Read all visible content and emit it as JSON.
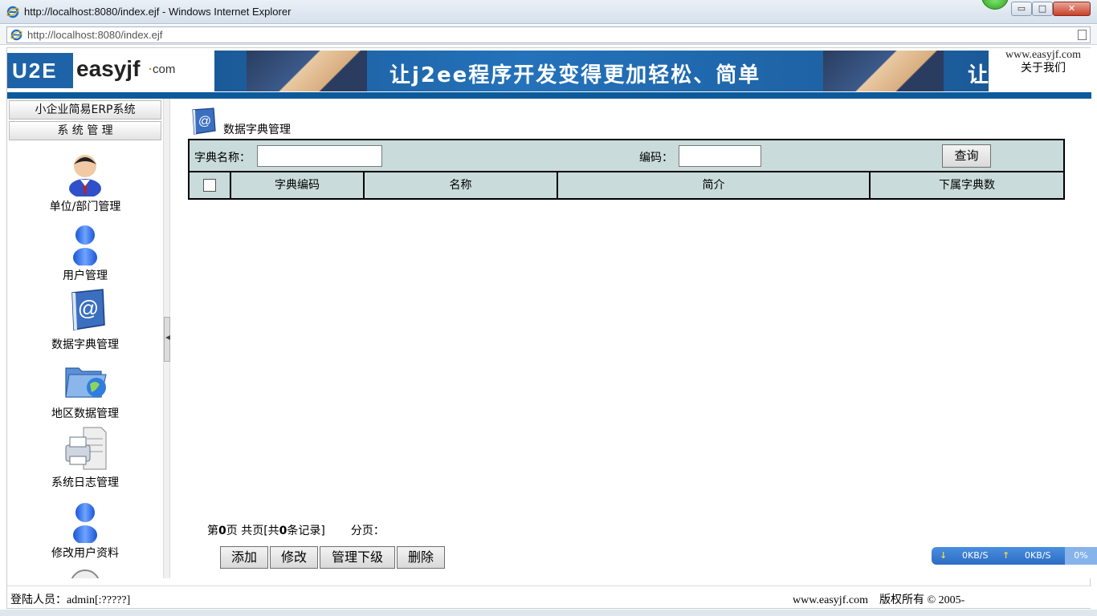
{
  "browser": {
    "window_title": "http://localhost:8080/index.ejf - Windows Internet Explorer",
    "url": "http://localhost:8080/index.ejf",
    "min_glyph": "▭",
    "max_glyph": "□",
    "close_glyph": "✕"
  },
  "header": {
    "logo_mark": "U2E",
    "logo_brand": "easyjf",
    "logo_dot": "·",
    "logo_suffix": "com",
    "banner_slogan": "让j2ee程序开发变得更加轻松、简单",
    "banner_slogan_cut": "让",
    "site": "www.easyjf.com",
    "about": "关于我们"
  },
  "sidebar": {
    "tabs": [
      "小企业简易ERP系统",
      "系 统 管 理"
    ],
    "items": [
      {
        "label": "单位/部门管理",
        "icon": "manager-person-icon"
      },
      {
        "label": "用户管理",
        "icon": "user-person-icon"
      },
      {
        "label": "数据字典管理",
        "icon": "address-book-icon"
      },
      {
        "label": "地区数据管理",
        "icon": "folder-globe-icon"
      },
      {
        "label": "系统日志管理",
        "icon": "printer-document-icon"
      },
      {
        "label": "修改用户资料",
        "icon": "user-person-icon"
      }
    ]
  },
  "main": {
    "title": "数据字典管理",
    "search": {
      "name_label": "字典名称：",
      "name_value": "",
      "code_label": "编码：",
      "code_value": "",
      "query_button": "查询"
    },
    "columns": [
      "",
      "字典编码",
      "名称",
      "简介",
      "下属字典数"
    ],
    "pager": {
      "page_prefix": "第",
      "page": "0",
      "total_text": "页 共页[共",
      "records": "0",
      "records_suffix": "条记录]",
      "paging_label": "分页："
    },
    "actions": [
      "添加",
      "修改",
      "管理下级",
      "删除"
    ]
  },
  "footer": {
    "user_label": "登陆人员：admin[:?????]",
    "site": "www.easyjf.com",
    "copyright": "版权所有 © 2005-"
  },
  "network": {
    "down_arrow": "↓",
    "down_speed": "0KB/S",
    "up_arrow": "↑",
    "up_speed": "0KB/S",
    "percent": "0%"
  },
  "colors": {
    "grid_bg": "#c9dbdb",
    "header_rule": "#0d5a9a",
    "banner_blue": "#2472bb"
  }
}
